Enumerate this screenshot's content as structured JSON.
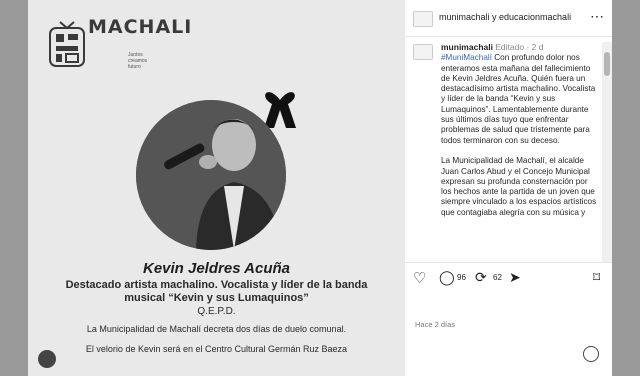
{
  "post": {
    "brand_name": "MACHALI",
    "brand_tagline": "Juntos creamos futuro",
    "name": "Kevin Jeldres Acuña",
    "description": "Destacado artista machalino. Vocalista y líder de la banda musical “Kevin y sus Lumaquinos”",
    "qepd": "Q.E.P.D.",
    "line1": "La Municipalidad de Machalí decreta dos días de duelo comunal.",
    "line2": "El velorio de Kevin será en el Centro Cultural Germán Ruz Baeza"
  },
  "sidebar": {
    "header_username": "munimachali y educacionmachali",
    "caption_user": "munimachali",
    "caption_meta": "Editado · 2 d",
    "caption_hashtag": "#MuniMachalí",
    "caption_text": "Con profundo dolor nos enteramos esta mañana del fallecimiento de Kevin Jeldres Acuña. Quién fuera un destacadísimo artista machalino. Vocalista y líder de la banda “Kevin y sus Lumaquinos”. Lamentablemente durante sus últimos días tuyo que enfrentar problemas de salud que tristemente para todos terminaron con su deceso.",
    "caption_text2": "La Municipalidad de Machalí, el alcalde Juan Carlos Abud y el Concejo Municipal expresan su profunda consternación por los hechos ante la partida de un joven que siempre vinculado a los espacios artísticos que contagiaba alegría con su música y",
    "comments_count": "96",
    "shares_count": "62",
    "time_ago": "Hace 2 días"
  }
}
